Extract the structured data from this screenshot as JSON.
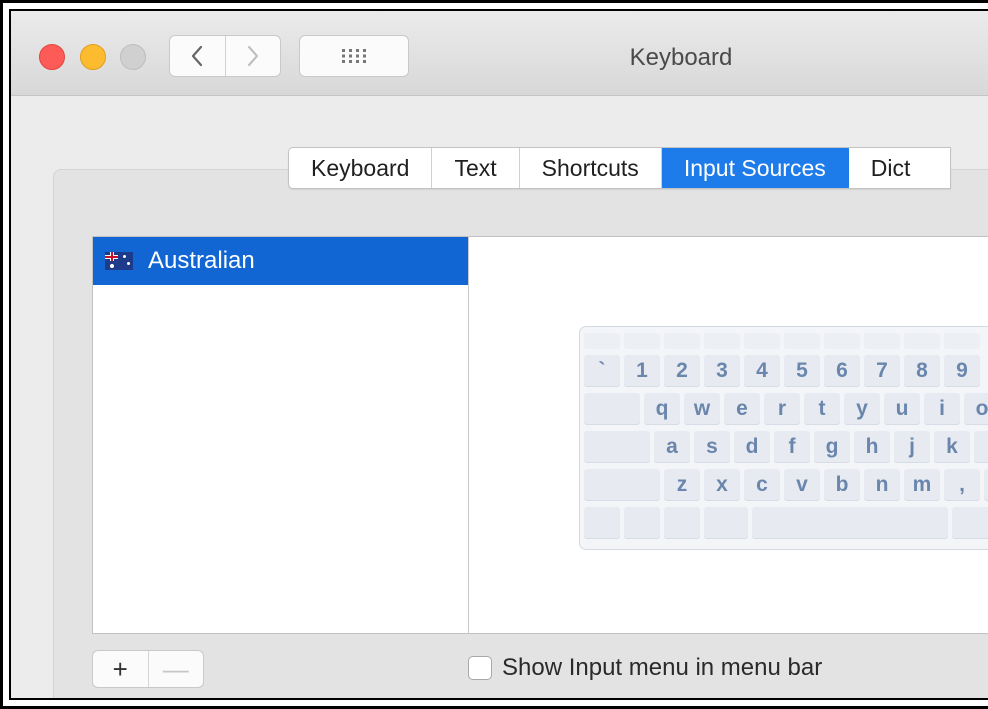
{
  "window": {
    "title": "Keyboard"
  },
  "toolbar": {
    "back_icon": "chevron-left-icon",
    "forward_icon": "chevron-right-icon",
    "show_all_icon": "grid-icon"
  },
  "tabs": [
    {
      "label": "Keyboard",
      "active": false
    },
    {
      "label": "Text",
      "active": false
    },
    {
      "label": "Shortcuts",
      "active": false
    },
    {
      "label": "Input Sources",
      "active": true
    },
    {
      "label": "Dict",
      "active": false
    }
  ],
  "input_sources": {
    "items": [
      {
        "label": "Australian",
        "icon": "australia-flag-icon",
        "selected": true
      }
    ]
  },
  "keyboard_preview": {
    "rows": [
      [
        "`",
        "1",
        "2",
        "3",
        "4",
        "5",
        "6",
        "7",
        "8",
        "9"
      ],
      [
        "q",
        "w",
        "e",
        "r",
        "t",
        "y",
        "u",
        "i",
        "o"
      ],
      [
        "a",
        "s",
        "d",
        "f",
        "g",
        "h",
        "j",
        "k"
      ],
      [
        "z",
        "x",
        "c",
        "v",
        "b",
        "n",
        "m",
        ","
      ]
    ]
  },
  "bottom": {
    "add_label": "+",
    "remove_label": "—",
    "show_input_menu_label": "Show Input menu in menu bar",
    "show_input_menu_checked": false
  },
  "colors": {
    "accent": "#1e7bea",
    "selection": "#1266d4",
    "close": "#fc5b57",
    "minimize": "#fdbb30"
  }
}
